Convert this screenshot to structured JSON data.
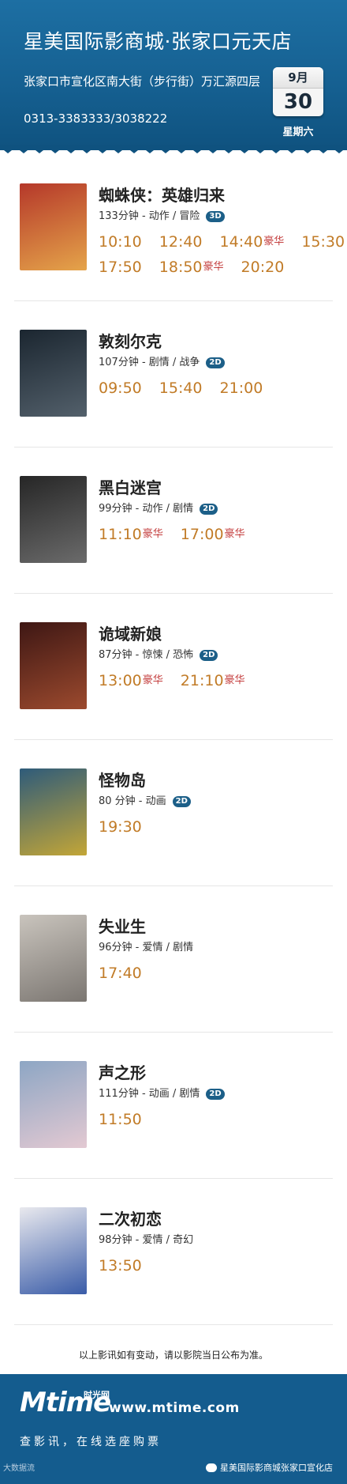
{
  "header": {
    "title": "星美国际影商城·张家口元天店",
    "address": "张家口市宣化区南大街（步行街）万汇源四层",
    "phone": "0313-3383333/3038222",
    "month": "9月",
    "day": "30",
    "weekday": "星期六"
  },
  "colors": {
    "header_bg": "#155f90",
    "time": "#c17b27",
    "luxury": "#c43f3f",
    "badge": "#1c5f88"
  },
  "movies": [
    {
      "title": "蜘蛛侠：英雄归来",
      "info": "133分钟 - 动作 / 冒险",
      "format": "3D",
      "rows": [
        [
          {
            "time": "10:10",
            "tag": ""
          },
          {
            "time": "12:40",
            "tag": ""
          },
          {
            "time": "14:40",
            "tag": "豪华"
          },
          {
            "time": "15:30",
            "tag": ""
          }
        ],
        [
          {
            "time": "17:50",
            "tag": ""
          },
          {
            "time": "18:50",
            "tag": "豪华"
          },
          {
            "time": "20:20",
            "tag": ""
          }
        ]
      ]
    },
    {
      "title": "敦刻尔克",
      "info": "107分钟 - 剧情 / 战争",
      "format": "2D",
      "rows": [
        [
          {
            "time": "09:50",
            "tag": ""
          },
          {
            "time": "15:40",
            "tag": ""
          },
          {
            "time": "21:00",
            "tag": ""
          }
        ]
      ]
    },
    {
      "title": "黑白迷宫",
      "info": "99分钟 - 动作 / 剧情",
      "format": "2D",
      "rows": [
        [
          {
            "time": "11:10",
            "tag": "豪华"
          },
          {
            "time": "17:00",
            "tag": "豪华"
          }
        ]
      ]
    },
    {
      "title": "诡域新娘",
      "info": "87分钟 - 惊悚 / 恐怖",
      "format": "2D",
      "rows": [
        [
          {
            "time": "13:00",
            "tag": "豪华"
          },
          {
            "time": "21:10",
            "tag": "豪华"
          }
        ]
      ]
    },
    {
      "title": "怪物岛",
      "info": "80 分钟 - 动画",
      "format": "2D",
      "rows": [
        [
          {
            "time": "19:30",
            "tag": ""
          }
        ]
      ]
    },
    {
      "title": "失业生",
      "info": "96分钟 - 爱情 / 剧情",
      "format": "",
      "rows": [
        [
          {
            "time": "17:40",
            "tag": ""
          }
        ]
      ]
    },
    {
      "title": "声之形",
      "info": "111分钟 - 动画 / 剧情",
      "format": "2D",
      "rows": [
        [
          {
            "time": "11:50",
            "tag": ""
          }
        ]
      ]
    },
    {
      "title": "二次初恋",
      "info": "98分钟 - 爱情 / 奇幻",
      "format": "",
      "rows": [
        [
          {
            "time": "13:50",
            "tag": ""
          }
        ]
      ]
    }
  ],
  "note": "以上影讯如有变动，请以影院当日公布为准。",
  "footer": {
    "logo_m": "M",
    "logo_text": "time",
    "logo_cn": "时光网",
    "site": "www.mtime.com",
    "slogan": "查影讯，在线选座购票",
    "watermark": "大数据流",
    "account": "星美国际影商城张家口宣化店"
  }
}
